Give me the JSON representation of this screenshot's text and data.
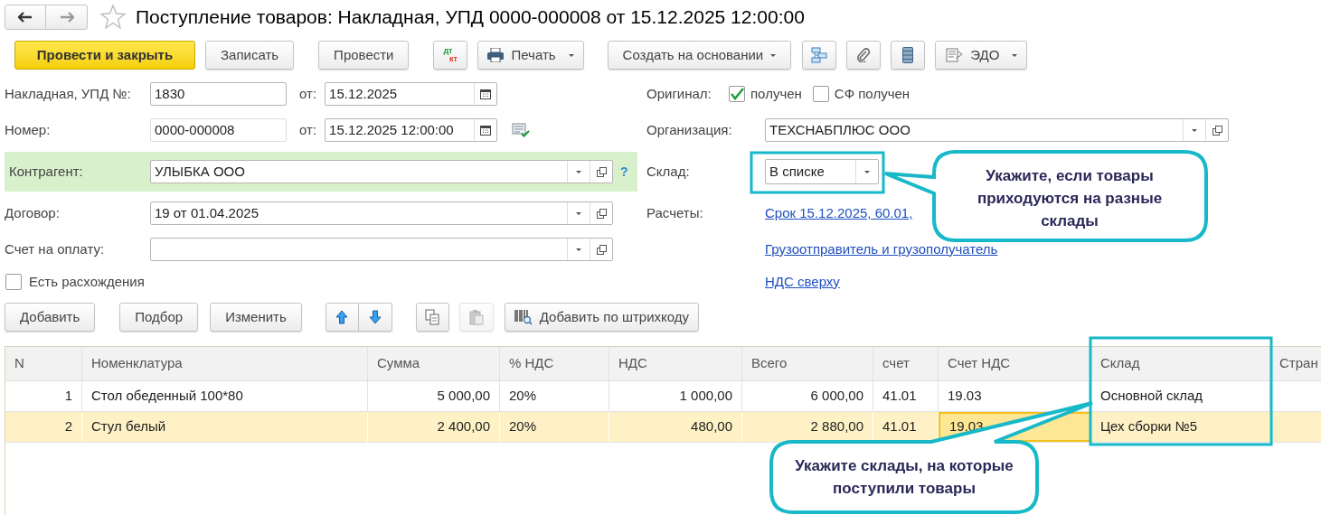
{
  "title": "Поступление товаров: Накладная, УПД 0000-000008 от 15.12.2025 12:00:00",
  "toolbar": [
    {
      "kind": "primary",
      "label": "Провести и закрыть"
    },
    {
      "kind": "text",
      "label": "Записать"
    },
    {
      "kind": "text",
      "label": "Провести"
    },
    {
      "kind": "dtkt",
      "dt": "дт",
      "kt": "кт"
    },
    {
      "kind": "print",
      "label": "Печать"
    },
    {
      "kind": "menu",
      "label": "Создать на основании"
    },
    {
      "kind": "structure"
    },
    {
      "kind": "attach"
    },
    {
      "kind": "list"
    },
    {
      "kind": "edo",
      "label": "ЭДО"
    }
  ],
  "invoice": {
    "label": "Накладная, УПД №:",
    "value": "1830",
    "date_label": "от:",
    "date": "15.12.2025"
  },
  "number": {
    "label": "Номер:",
    "value": "0000-000008",
    "date_label": "от:",
    "date": "15.12.2025 12:00:00"
  },
  "counterparty": {
    "label": "Контрагент:",
    "value": "УЛЫБКА ООО",
    "highlighted": true,
    "help": "?"
  },
  "contract": {
    "label": "Договор:",
    "value": "19 от 01.04.2025"
  },
  "payment_invoice": {
    "label": "Счет на оплату:"
  },
  "discrepancies": {
    "label": "Есть расхождения",
    "checked": false
  },
  "original": {
    "label": "Оригинал:",
    "checks": [
      {
        "label": "получен",
        "checked": true
      },
      {
        "label": "СФ получен",
        "checked": false
      }
    ]
  },
  "organization": {
    "label": "Организация:",
    "value": "ТЕХСНАБПЛЮС ООО"
  },
  "warehouse": {
    "label": "Склад:",
    "value": "В списке"
  },
  "settlements": {
    "label": "Расчеты:",
    "link": "Срок 15.12.2025, 60.01,"
  },
  "links": [
    "Грузоотправитель и грузополучатель",
    "НДС сверху"
  ],
  "table_toolbar": [
    {
      "kind": "text",
      "label": "Добавить",
      "disabled": false
    },
    {
      "kind": "text",
      "label": "Подбор",
      "disabled": false
    },
    {
      "kind": "text",
      "label": "Изменить",
      "disabled": false
    },
    {
      "kind": "up",
      "disabled": false
    },
    {
      "kind": "down",
      "disabled": false
    },
    {
      "kind": "copy",
      "disabled": false
    },
    {
      "kind": "paste",
      "disabled": true
    },
    {
      "kind": "barcode",
      "label": "Добавить по штрихкоду",
      "disabled": false
    }
  ],
  "table": {
    "columns": [
      "N",
      "Номенклатура",
      "Сумма",
      "% НДС",
      "НДС",
      "Всего",
      "счет",
      "Счет НДС",
      "Склад",
      "Стран"
    ],
    "rows": [
      {
        "selected": false,
        "cells": [
          {
            "text": "1",
            "focused": false
          },
          {
            "text": "Стол обеденный 100*80",
            "focused": false
          },
          {
            "text": "5 000,00",
            "focused": false
          },
          {
            "text": "20%",
            "focused": false
          },
          {
            "text": "1 000,00",
            "focused": false
          },
          {
            "text": "6 000,00",
            "focused": false
          },
          {
            "text": "41.01",
            "focused": false
          },
          {
            "text": "19.03",
            "focused": false
          },
          {
            "text": "Основной склад",
            "focused": false
          }
        ]
      },
      {
        "selected": true,
        "cells": [
          {
            "text": "2",
            "focused": false
          },
          {
            "text": "Стул белый",
            "focused": false
          },
          {
            "text": "2 400,00",
            "focused": false
          },
          {
            "text": "20%",
            "focused": false
          },
          {
            "text": "480,00",
            "focused": false
          },
          {
            "text": "2 880,00",
            "focused": false
          },
          {
            "text": "41.01",
            "focused": false
          },
          {
            "text": "19.03",
            "focused": true
          },
          {
            "text": "Цех сборки №5",
            "focused": false
          }
        ]
      }
    ]
  },
  "callouts": [
    {
      "text": "Укажите, если товары приходуются на разные склады"
    },
    {
      "text": "Укажите склады, на которые поступили товары"
    }
  ]
}
